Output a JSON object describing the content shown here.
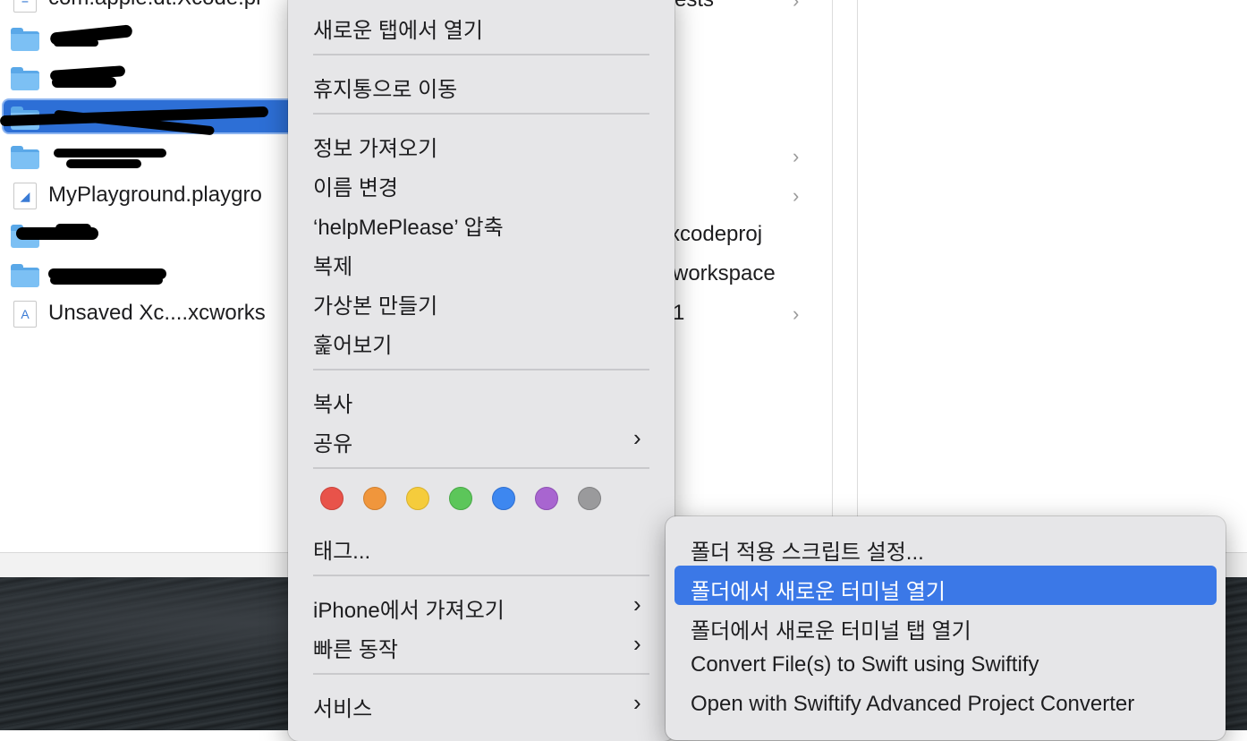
{
  "finder": {
    "files": [
      {
        "name": "com.apple.dt.Xcode.pl",
        "icon": "document-icon"
      },
      {
        "name": "",
        "icon": "folder-icon"
      },
      {
        "name": "",
        "icon": "folder-icon"
      },
      {
        "name": "",
        "icon": "folder-icon",
        "selected": true
      },
      {
        "name": "",
        "icon": "folder-icon"
      },
      {
        "name": "MyPlayground.playgro",
        "icon": "swift-playground-icon"
      },
      {
        "name": "",
        "icon": "folder-icon"
      },
      {
        "name": "",
        "icon": "folder-icon"
      },
      {
        "name": "Unsaved Xc....xcworks",
        "icon": "xcode-workspace-icon"
      }
    ],
    "column2": [
      "ests",
      "xcodeproj",
      "workspace",
      "1"
    ]
  },
  "context_menu": {
    "open_new_tab": "새로운 탭에서 열기",
    "move_to_trash": "휴지통으로 이동",
    "get_info": "정보 가져오기",
    "rename": "이름 변경",
    "compress": "‘helpMePlease’ 압축",
    "duplicate": "복제",
    "make_alias": "가상본 만들기",
    "quick_look": "훑어보기",
    "copy": "복사",
    "share": "공유",
    "tags": "태그...",
    "import_from_iphone": "iPhone에서 가져오기",
    "quick_actions": "빠른 동작",
    "services": "서비스",
    "tag_colors": [
      "#e8534a",
      "#f0963c",
      "#f5cc3c",
      "#5cc65a",
      "#3d87f0",
      "#a865d0",
      "#9a9a9c"
    ]
  },
  "services_submenu": {
    "items": [
      "폴더 적용 스크립트 설정...",
      "폴더에서 새로운 터미널 열기",
      "폴더에서 새로운 터미널 탭 열기",
      "Convert File(s) to Swift using Swiftify",
      "Open with Swiftify Advanced Project Converter"
    ],
    "highlighted_index": 1,
    "highlight_color": "#3b78e7"
  }
}
